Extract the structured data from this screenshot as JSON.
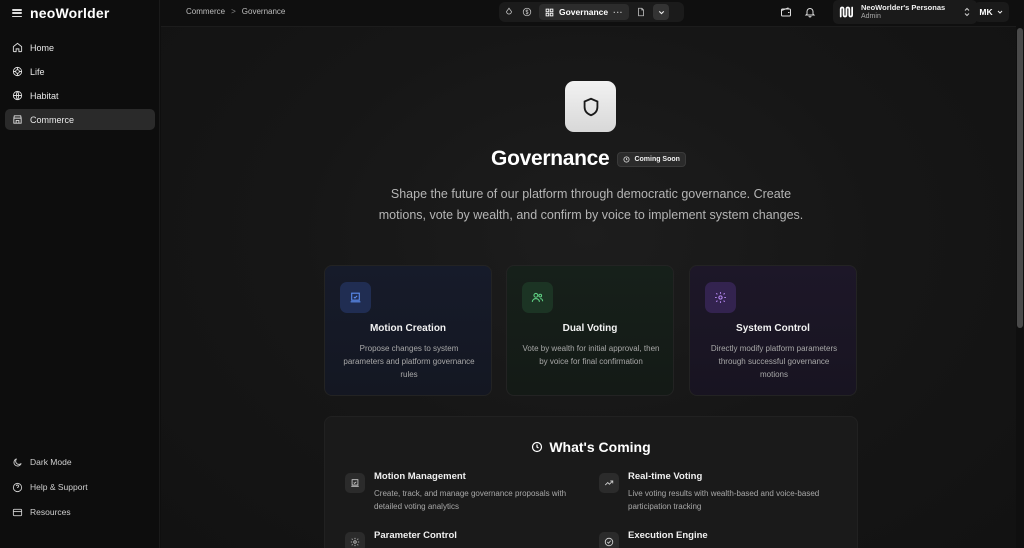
{
  "brand": {
    "name": "neoWorlder"
  },
  "sidebar": {
    "items": [
      {
        "label": "Home",
        "icon": "home-icon"
      },
      {
        "label": "Life",
        "icon": "life-icon"
      },
      {
        "label": "Habitat",
        "icon": "globe-icon"
      },
      {
        "label": "Commerce",
        "icon": "store-icon",
        "active": true
      }
    ],
    "bottom": [
      {
        "label": "Dark Mode",
        "icon": "moon-icon"
      },
      {
        "label": "Help & Support",
        "icon": "help-icon"
      },
      {
        "label": "Resources",
        "icon": "resources-icon"
      }
    ]
  },
  "breadcrumb": {
    "parent": "Commerce",
    "separator": ">",
    "current": "Governance"
  },
  "toolbar": {
    "active_tool": "Governance",
    "more": "···"
  },
  "persona": {
    "name": "NeoWorlder's Personas",
    "role": "Admin"
  },
  "user": {
    "initials": "MK"
  },
  "hero": {
    "title": "Governance",
    "badge": "Coming Soon",
    "description": "Shape the future of our platform through democratic governance. Create motions, vote by wealth, and confirm by voice to implement system changes."
  },
  "cards": [
    {
      "title": "Motion Creation",
      "description": "Propose changes to system parameters and platform governance rules",
      "accent": "#3b6cd6"
    },
    {
      "title": "Dual Voting",
      "description": "Vote by wealth for initial approval, then by voice for final confirmation",
      "accent": "#4cae6b"
    },
    {
      "title": "System Control",
      "description": "Directly modify platform parameters through successful governance motions",
      "accent": "#9b6ad8"
    }
  ],
  "coming": {
    "title": "What's Coming",
    "features": [
      {
        "title": "Motion Management",
        "description": "Create, track, and manage governance proposals with detailed voting analytics"
      },
      {
        "title": "Real-time Voting",
        "description": "Live voting results with wealth-based and voice-based participation tracking"
      },
      {
        "title": "Parameter Control",
        "description": ""
      },
      {
        "title": "Execution Engine",
        "description": ""
      }
    ]
  }
}
